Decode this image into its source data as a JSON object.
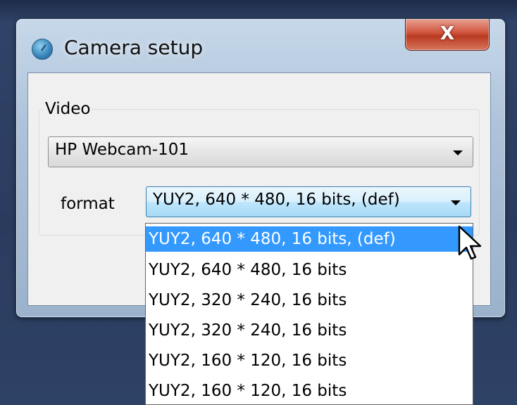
{
  "window": {
    "title": "Camera setup",
    "close_label": "X"
  },
  "video_group": {
    "label": "Video",
    "camera_select": {
      "value": "HP Webcam-101"
    },
    "format_label": "format",
    "format_select": {
      "value": "YUY2, 640 * 480, 16 bits, (def)"
    }
  },
  "format_options": [
    {
      "label": "YUY2, 640 * 480, 16 bits, (def)",
      "selected": true
    },
    {
      "label": "YUY2, 640 * 480, 16 bits",
      "selected": false
    },
    {
      "label": "YUY2, 320 * 240, 16 bits",
      "selected": false
    },
    {
      "label": "YUY2, 320 * 240, 16 bits",
      "selected": false
    },
    {
      "label": "YUY2, 160 * 120, 16 bits",
      "selected": false
    },
    {
      "label": "YUY2, 160 * 120, 16 bits",
      "selected": false
    }
  ],
  "colors": {
    "selection": "#3399ff",
    "close_button": "#c84a32",
    "desktop": "#2e4266"
  },
  "icons": {
    "title": "camera-app-icon",
    "cursor": "mouse-pointer-icon"
  }
}
